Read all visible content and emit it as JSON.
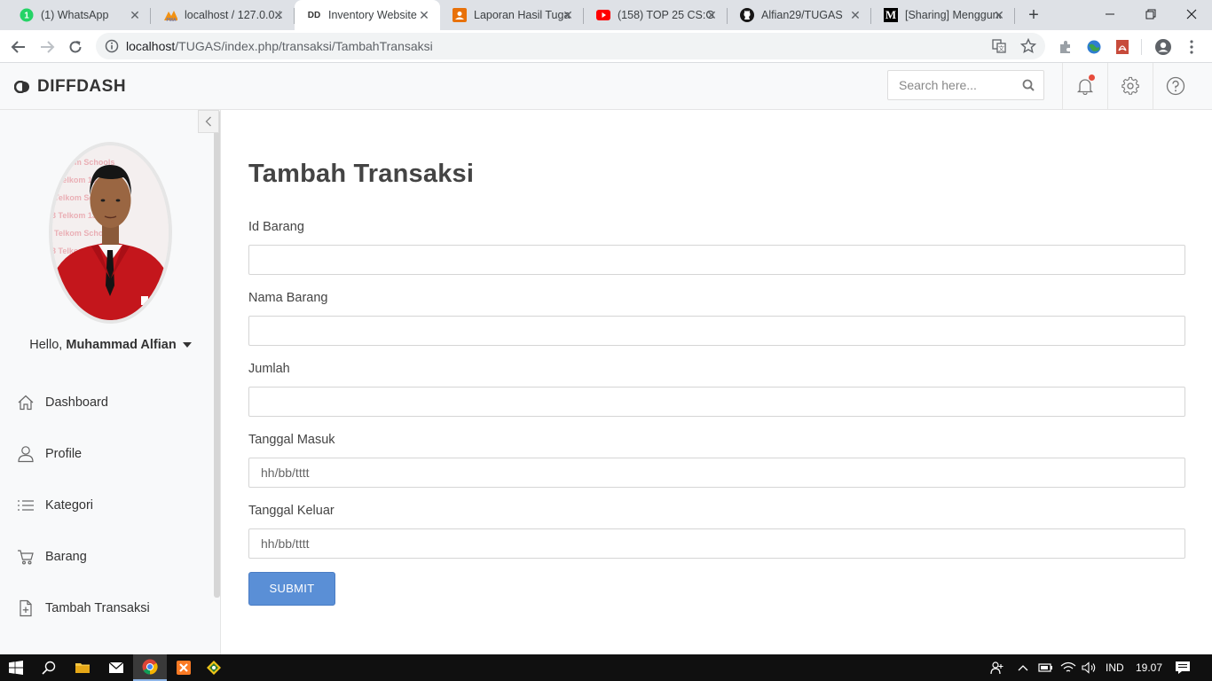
{
  "browser": {
    "tabs": [
      {
        "title": "(1) WhatsApp",
        "icon": "whatsapp-icon"
      },
      {
        "title": "localhost / 127.0.0.1",
        "icon": "phpmyadmin-icon"
      },
      {
        "title": "Inventory Website",
        "icon": "diffdash-icon",
        "favicon_text": "DD"
      },
      {
        "title": "Laporan Hasil Tugas",
        "icon": "classroom-icon"
      },
      {
        "title": "(158) TOP 25 CS:GO",
        "icon": "youtube-icon"
      },
      {
        "title": "Alfian29/TUGAS",
        "icon": "github-icon"
      },
      {
        "title": "[Sharing] Menggunakan",
        "icon": "medium-icon",
        "favicon_text": "M"
      }
    ],
    "address": {
      "host": "localhost",
      "path": "/TUGAS/index.php/transaksi/TambahTransaksi"
    }
  },
  "app": {
    "logo_text": "DIFFDASH",
    "search_placeholder": "Search here...",
    "user": {
      "greeting": "Hello, ",
      "name": "Muhammad Alfian"
    },
    "nav": [
      {
        "label": "Dashboard",
        "icon": "home-icon"
      },
      {
        "label": "Profile",
        "icon": "user-icon"
      },
      {
        "label": "Kategori",
        "icon": "list-icon"
      },
      {
        "label": "Barang",
        "icon": "cart-icon"
      },
      {
        "label": "Tambah Transaksi",
        "icon": "file-add-icon"
      }
    ],
    "form": {
      "title": "Tambah Transaksi",
      "fields": [
        {
          "label": "Id Barang",
          "value": ""
        },
        {
          "label": "Nama Barang",
          "value": ""
        },
        {
          "label": "Jumlah",
          "value": ""
        },
        {
          "label": "Tanggal Masuk",
          "value": "hh/bb/tttt"
        },
        {
          "label": "Tanggal Keluar",
          "value": "hh/bb/tttt"
        }
      ],
      "submit_label": "SUBMIT"
    }
  },
  "taskbar": {
    "language": "IND",
    "time": "19.07"
  },
  "colors": {
    "accent": "#5a8fd6",
    "notification": "#e74c3c"
  }
}
